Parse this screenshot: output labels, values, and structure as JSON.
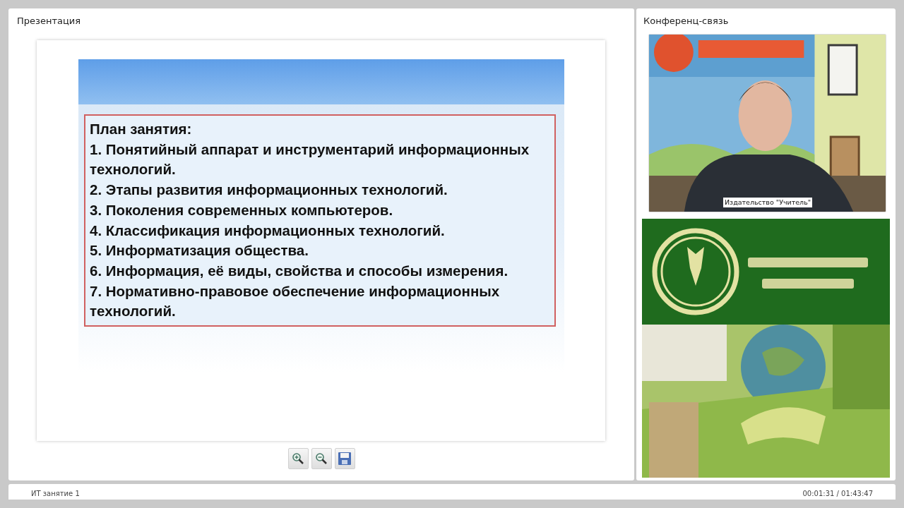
{
  "presentation": {
    "title": "Презентация",
    "slide": {
      "heading": "План занятия:",
      "items": [
        "1. Понятийный аппарат и инструментарий информационных технологий.",
        "2. Этапы развития информационных технологий.",
        "3. Поколения современных компьютеров.",
        "4. Классификация информационных технологий.",
        "5. Информатизация общества.",
        "6. Информация, её виды, свойства и способы измерения.",
        "7. Нормативно-правовое обеспечение информационных технологий."
      ]
    },
    "toolbar": [
      {
        "kind": "zoom-in"
      },
      {
        "kind": "zoom-out"
      },
      {
        "kind": "save"
      }
    ]
  },
  "conference": {
    "title": "Конференц-связь",
    "video": {
      "caption": "Издательство \"Учитель\""
    }
  },
  "status_bar": {
    "lesson": "ИТ занятие 1",
    "time": "00:01:31 / 01:43:47"
  }
}
